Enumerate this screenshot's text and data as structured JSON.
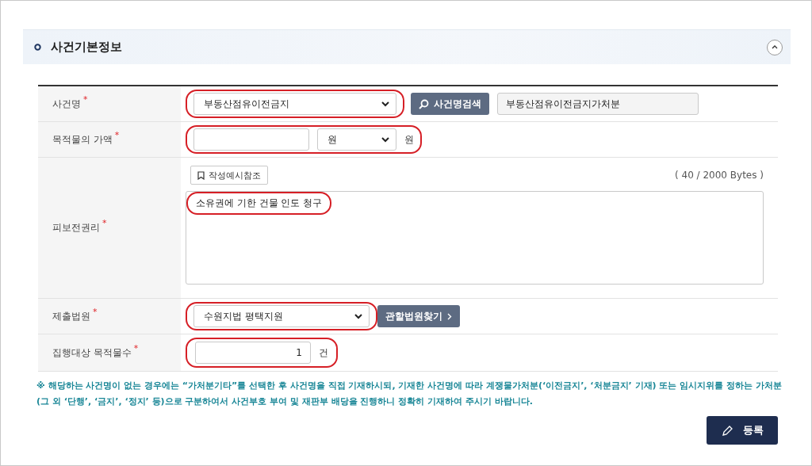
{
  "section": {
    "title": "사건기본정보",
    "expanded": true
  },
  "rows": [
    {
      "kind": "case-name",
      "label": "사건명",
      "required_mark": "*",
      "highlighted": true,
      "select_value": "부동산점유이전금지",
      "button": "사건명검색",
      "result_value": "부동산점유이전금지가처분"
    },
    {
      "kind": "amount",
      "label": "목적물의 가액",
      "required_mark": "*",
      "highlighted": true,
      "unit_select": "원",
      "unit": "원"
    },
    {
      "kind": "text",
      "label": "피보전권리",
      "required_mark": "*",
      "highlighted": true,
      "example_button": "작성예시참조",
      "byte_count": "( 40 / 2000 Bytes )",
      "value": "소유권에 기한 건물 인도 청구"
    },
    {
      "kind": "court",
      "label": "제출법원",
      "required_mark": "*",
      "highlighted": true,
      "select_value": "수원지법 평택지원",
      "button": "관할법원찾기"
    },
    {
      "kind": "count",
      "label": "집행대상 목적물수",
      "required_mark": "*",
      "highlighted": true,
      "value": "1",
      "unit": "건"
    }
  ],
  "note": "※ 해당하는 사건명이 없는 경우에는 “가처분기타”를 선택한 후 사건명을 직접 기재하시되, 기재한 사건명에 따라 계쟁물가처분(‘이전금지’, ‘처분금지’ 기재) 또는 임시지위를 정하는 가처분(그 외 ‘단행’, ‘금지’, ‘정지’ 등)으로 구분하여서 사건부호 부여 및 재판부 배당을 진행하니 정확히 기재하여 주시기 바랍니다.",
  "submit_button": "등록"
}
